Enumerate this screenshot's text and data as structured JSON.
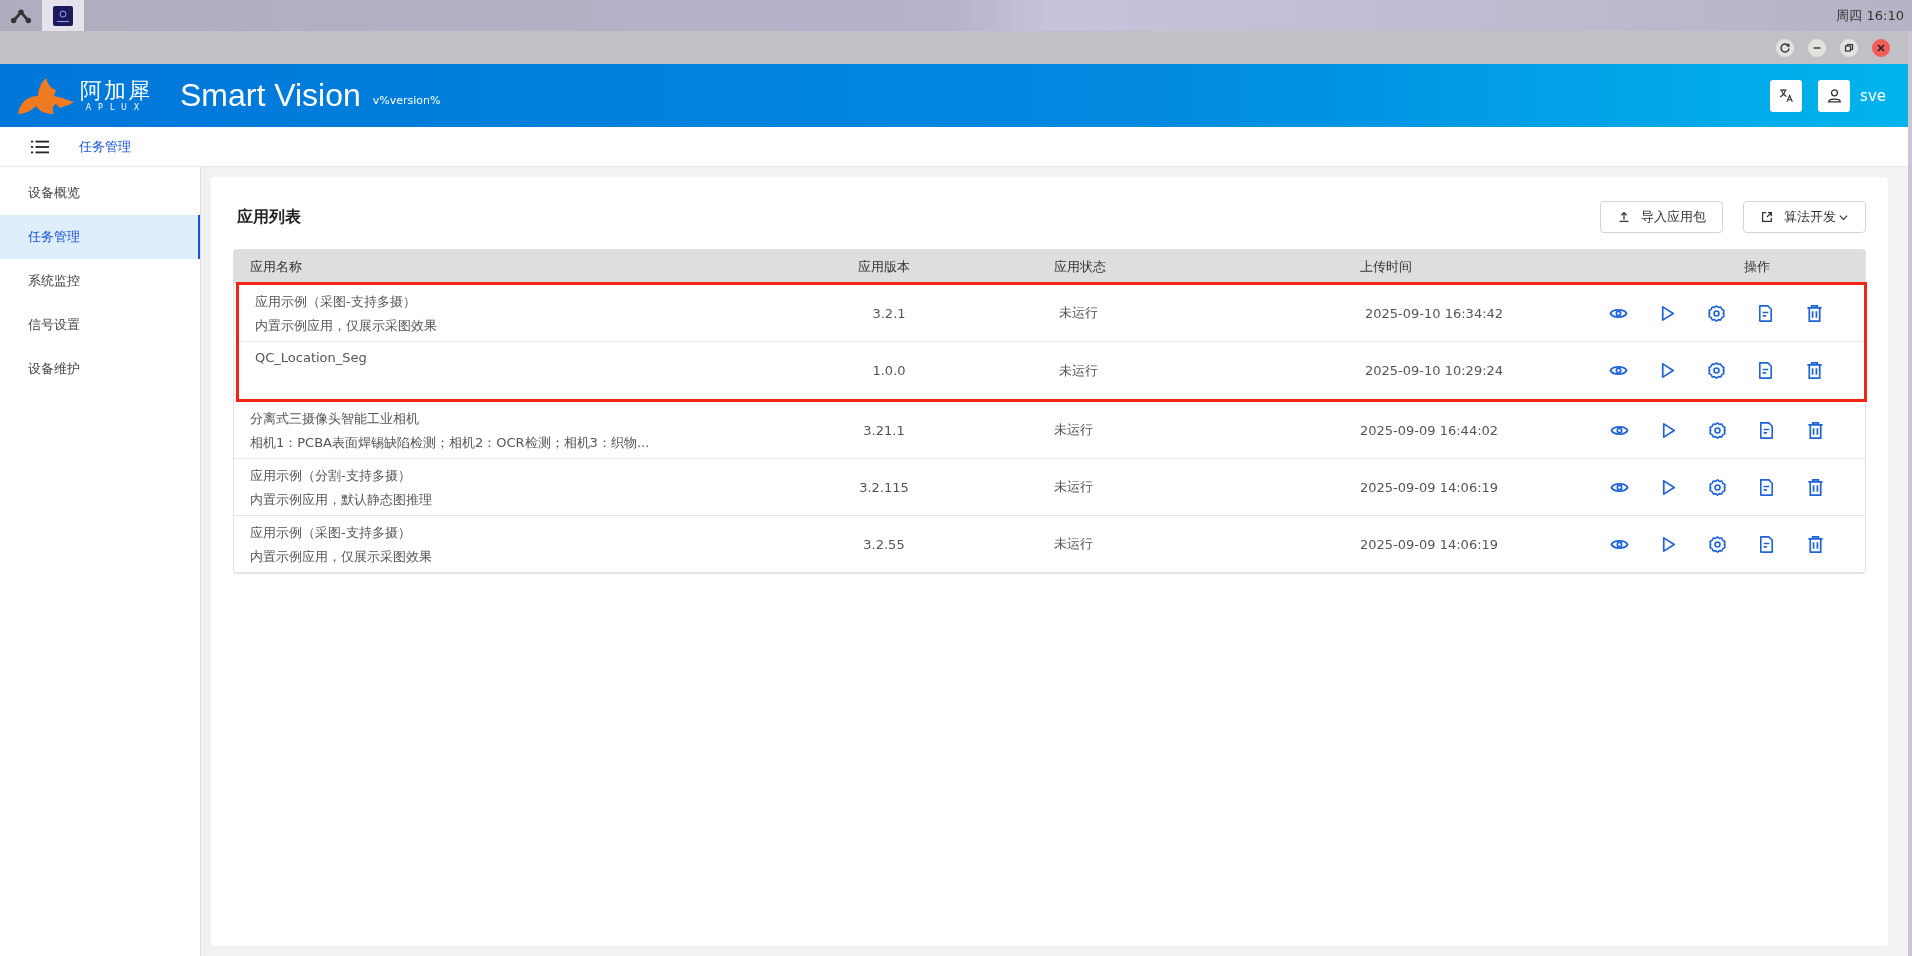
{
  "taskbar": {
    "clock": "周四 16:10"
  },
  "header": {
    "logo_name": "阿加犀",
    "logo_sub": "APLUX",
    "title": "Smart Vision",
    "version": "v%version%",
    "user": "sve"
  },
  "breadcrumb": {
    "current": "任务管理"
  },
  "sidebar": {
    "items": [
      {
        "label": "设备概览",
        "selected": false
      },
      {
        "label": "任务管理",
        "selected": true
      },
      {
        "label": "系统监控",
        "selected": false
      },
      {
        "label": "信号设置",
        "selected": false
      },
      {
        "label": "设备维护",
        "selected": false
      }
    ]
  },
  "panel": {
    "title": "应用列表",
    "buttons": [
      {
        "kind": "upload",
        "label": "导入应用包"
      },
      {
        "kind": "external",
        "label": "算法开发"
      }
    ]
  },
  "table": {
    "columns": [
      "应用名称",
      "应用版本",
      "应用状态",
      "上传时间",
      "操作"
    ],
    "rows": [
      {
        "name": "应用示例（采图-支持多摄）",
        "description": "内置示例应用，仅展示采图效果",
        "version": "3.2.1",
        "status": "未运行",
        "uploaded": "2025-09-10 16:34:42",
        "highlighted": true
      },
      {
        "name": "QC_Location_Seg",
        "version": "1.0.0",
        "status": "未运行",
        "uploaded": "2025-09-10 10:29:24",
        "highlighted": true
      },
      {
        "name": "分离式三摄像头智能工业相机",
        "description": "相机1：PCBA表面焊锡缺陷检测；相机2：OCR检测；相机3：织物...",
        "version": "3.21.1",
        "status": "未运行",
        "uploaded": "2025-09-09 16:44:02",
        "highlighted": false
      },
      {
        "name": "应用示例（分割-支持多摄）",
        "description": "内置示例应用，默认静态图推理",
        "version": "3.2.115",
        "status": "未运行",
        "uploaded": "2025-09-09 14:06:19",
        "highlighted": false
      },
      {
        "name": "应用示例（采图-支持多摄）",
        "description": "内置示例应用，仅展示采图效果",
        "version": "3.2.55",
        "status": "未运行",
        "uploaded": "2025-09-09 14:06:19",
        "highlighted": false
      }
    ]
  }
}
